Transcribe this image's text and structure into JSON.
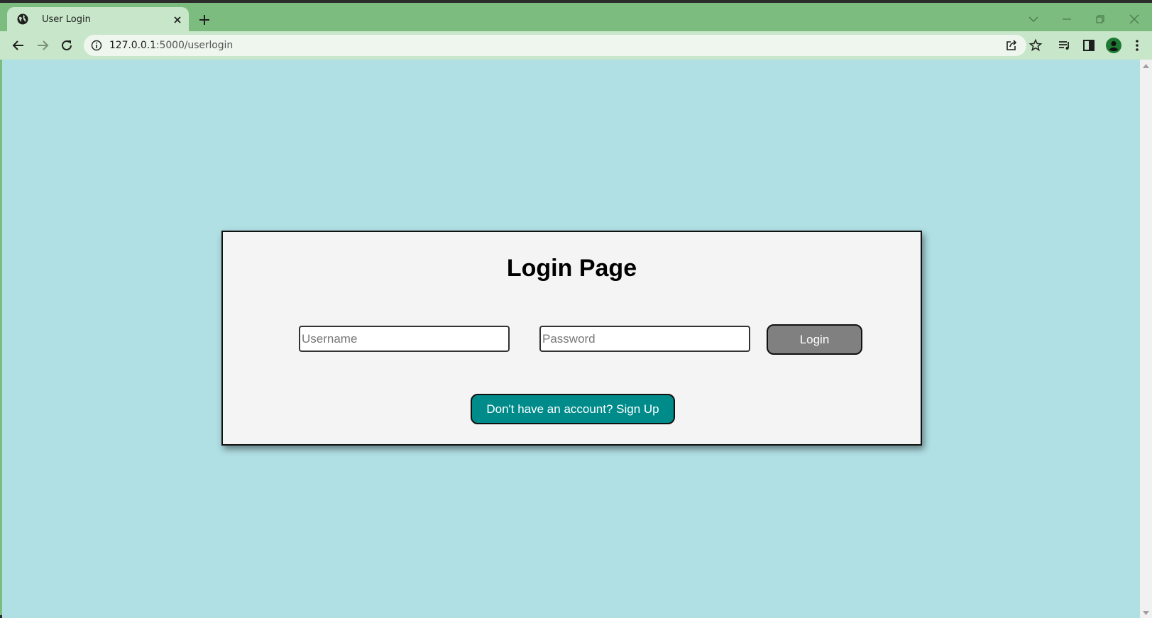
{
  "browser": {
    "tab_title": "User Login",
    "url_host": "127.0.0.1",
    "url_path": ":5000/userlogin"
  },
  "login": {
    "heading": "Login Page",
    "username_placeholder": "Username",
    "password_placeholder": "Password",
    "login_label": "Login",
    "signup_label": "Don't have an account? Sign Up"
  },
  "colors": {
    "chrome_frame": "#7cbd7f",
    "chrome_toolbar": "#c8e6c9",
    "page_background": "#b0dfe4",
    "card_background": "#f4f4f4",
    "login_button": "#808080",
    "signup_button": "#008b8b"
  }
}
